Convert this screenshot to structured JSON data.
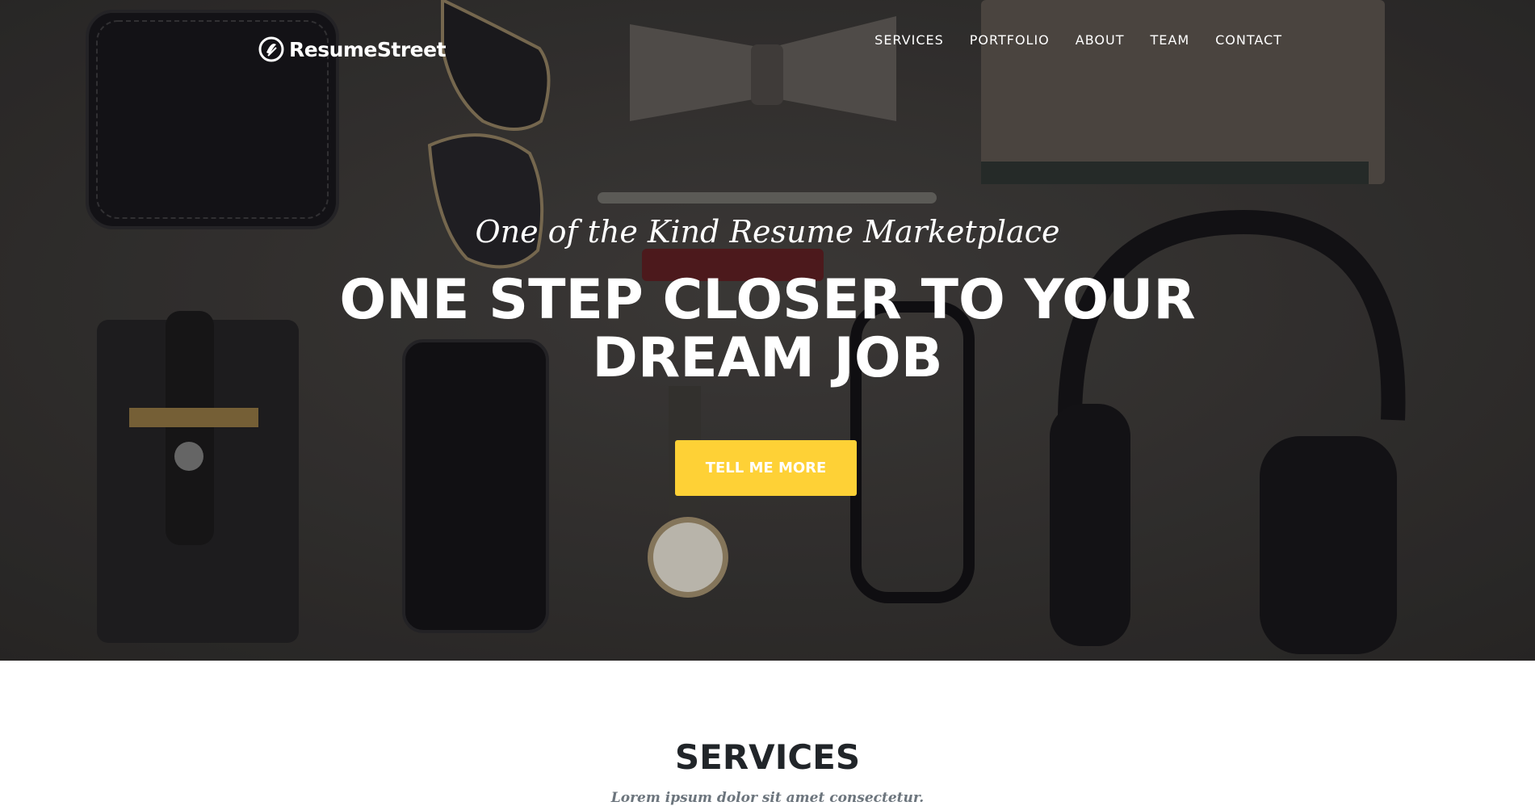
{
  "brand": {
    "name": "ResumeStreet",
    "icon": "resumestreet-logo-icon"
  },
  "nav": {
    "items": [
      {
        "label": "SERVICES"
      },
      {
        "label": "PORTFOLIO"
      },
      {
        "label": "ABOUT"
      },
      {
        "label": "TEAM"
      },
      {
        "label": "CONTACT"
      }
    ]
  },
  "hero": {
    "subheading": "One of the Kind Resume Marketplace",
    "heading_line1": "ONE STEP CLOSER TO YOUR",
    "heading_line2": "DREAM JOB",
    "cta_label": "TELL ME MORE",
    "background": "flat-lay-accessories-photo"
  },
  "services": {
    "title": "SERVICES",
    "subtitle": "Lorem ipsum dolor sit amet consectetur."
  },
  "colors": {
    "accent": "#fed136",
    "hero_bg": "#3a3836",
    "heading_dark": "#212529",
    "muted_text": "#6c757d"
  }
}
